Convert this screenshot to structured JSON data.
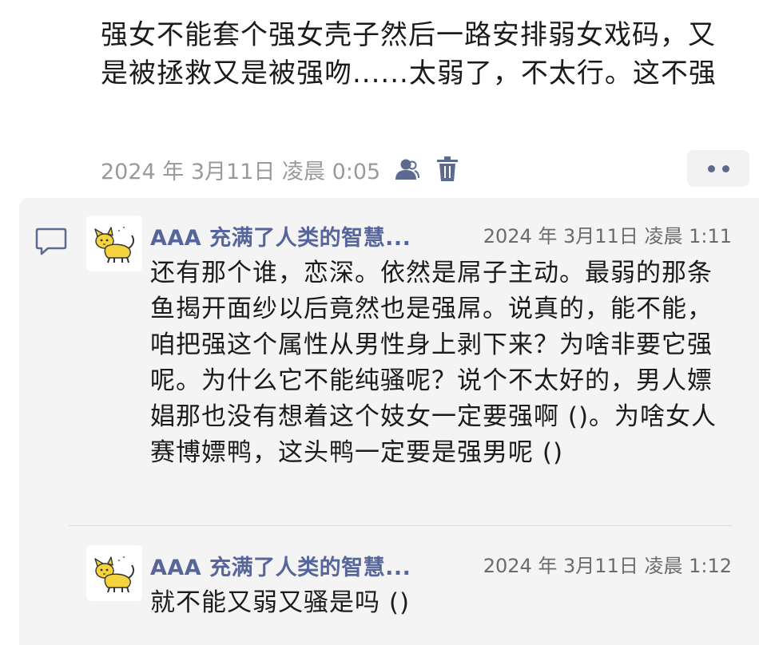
{
  "post": {
    "text": "强女不能套个强女壳子然后一路安排弱女戏码，又是被拯救又是被强吻......太弱了，不太行。这不强",
    "date": "2024 年 3月11日 凌晨 0:05",
    "icons": [
      "visibility-icon",
      "trash-icon"
    ],
    "more_icon": "more-dots-icon"
  },
  "comments": [
    {
      "author": "AAA 充满了人类的智慧...",
      "date": "2024 年 3月11日 凌晨 1:11",
      "avatar_icon": "cat-avatar-icon",
      "text": "还有那个谁，恋深。依然是屌子主动。最弱的那条鱼揭开面纱以后竟然也是强屌。说真的，能不能，咱把强这个属性从男性身上剥下来？为啥非要它强呢。为什么它不能纯骚呢？说个不太好的，男人嫖娼那也没有想着这个妓女一定要强啊 ()。为啥女人赛博嫖鸭，这头鸭一定要是强男呢 ()"
    },
    {
      "author": "AAA 充满了人类的智慧...",
      "date": "2024 年 3月11日 凌晨 1:12",
      "avatar_icon": "cat-avatar-icon",
      "text": "就不能又弱又骚是吗 ()"
    }
  ],
  "colors": {
    "accent": "#57669a",
    "panel_bg": "#f4f4f4",
    "meta_text": "#9a9a9a",
    "avatar_yellow": "#f5d33c"
  }
}
